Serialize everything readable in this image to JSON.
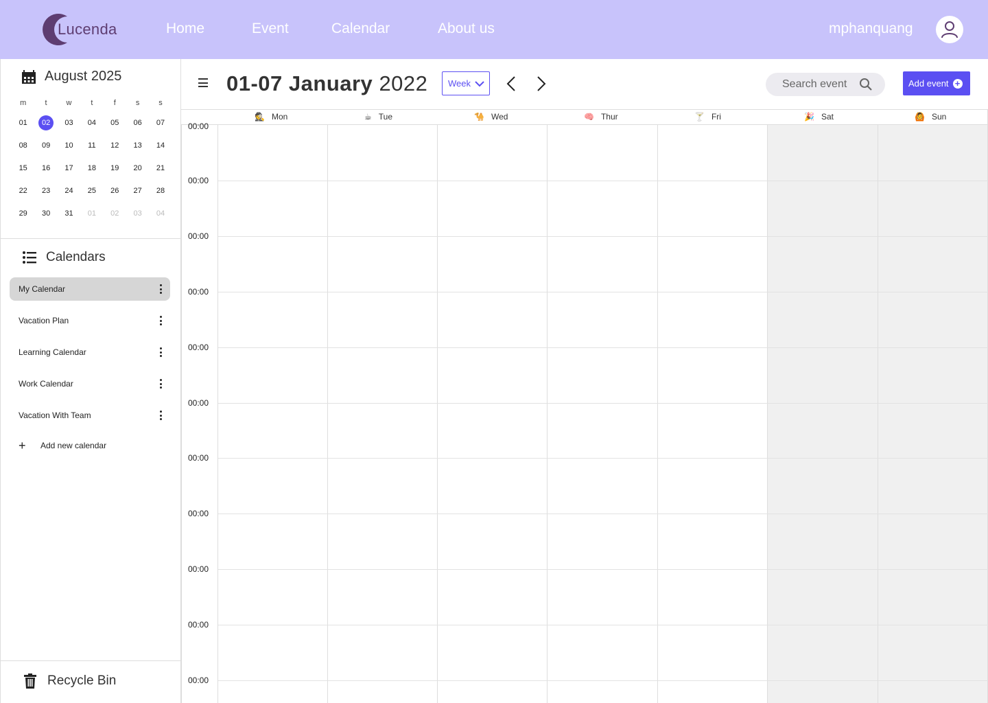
{
  "header": {
    "logo_text": "Lucenda",
    "nav": [
      "Home",
      "Event",
      "Calendar",
      "About us"
    ],
    "username": "mphanquang"
  },
  "mini_calendar": {
    "month": "August",
    "year": "2025",
    "weekdays": [
      "m",
      "t",
      "w",
      "t",
      "f",
      "s",
      "s"
    ],
    "days": [
      "01",
      "02",
      "03",
      "04",
      "05",
      "06",
      "07",
      "08",
      "09",
      "10",
      "11",
      "12",
      "13",
      "14",
      "15",
      "16",
      "17",
      "18",
      "19",
      "20",
      "21",
      "22",
      "23",
      "24",
      "25",
      "26",
      "27",
      "28",
      "29",
      "30",
      "31",
      "01",
      "02",
      "03",
      "04"
    ],
    "selected": "02"
  },
  "calendars": {
    "title": "Calendars",
    "items": [
      "My Calendar",
      "Vacation Plan",
      "Learning Calendar",
      "Work Calendar",
      "Vacation With Team"
    ],
    "add_label": "Add new calendar"
  },
  "recycle_bin": "Recycle Bin",
  "toolbar": {
    "range_days": "01-07 January",
    "range_year": "2022",
    "view": "Week",
    "search_placeholder": "Search event",
    "add_event": "Add event"
  },
  "week_days": [
    {
      "emoji": "🕵",
      "label": "Mon"
    },
    {
      "emoji": "☕",
      "label": "Tue"
    },
    {
      "emoji": "🐪",
      "label": "Wed"
    },
    {
      "emoji": "🧠",
      "label": "Thur"
    },
    {
      "emoji": "🍸",
      "label": "Fri"
    },
    {
      "emoji": "🎉",
      "label": "Sat"
    },
    {
      "emoji": "🙆",
      "label": "Sun"
    }
  ],
  "time_labels": [
    "00:00",
    "00:00",
    "00:00",
    "00:00",
    "00:00",
    "00:00",
    "00:00",
    "00:00",
    "00:00",
    "00:00",
    "00:00"
  ],
  "colors": {
    "header_bg": "#c8c3fb",
    "accent": "#5b4ff2",
    "weekend_bg": "#f0f0f0"
  }
}
